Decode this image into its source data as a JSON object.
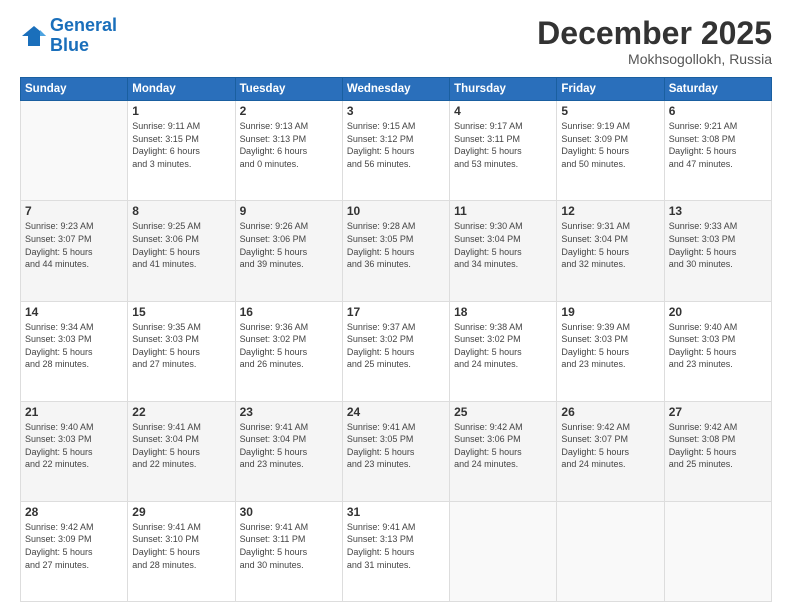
{
  "header": {
    "logo_line1": "General",
    "logo_line2": "Blue",
    "month": "December 2025",
    "location": "Mokhsogollokh, Russia"
  },
  "days_of_week": [
    "Sunday",
    "Monday",
    "Tuesday",
    "Wednesday",
    "Thursday",
    "Friday",
    "Saturday"
  ],
  "weeks": [
    [
      {
        "day": "",
        "info": ""
      },
      {
        "day": "1",
        "info": "Sunrise: 9:11 AM\nSunset: 3:15 PM\nDaylight: 6 hours\nand 3 minutes."
      },
      {
        "day": "2",
        "info": "Sunrise: 9:13 AM\nSunset: 3:13 PM\nDaylight: 6 hours\nand 0 minutes."
      },
      {
        "day": "3",
        "info": "Sunrise: 9:15 AM\nSunset: 3:12 PM\nDaylight: 5 hours\nand 56 minutes."
      },
      {
        "day": "4",
        "info": "Sunrise: 9:17 AM\nSunset: 3:11 PM\nDaylight: 5 hours\nand 53 minutes."
      },
      {
        "day": "5",
        "info": "Sunrise: 9:19 AM\nSunset: 3:09 PM\nDaylight: 5 hours\nand 50 minutes."
      },
      {
        "day": "6",
        "info": "Sunrise: 9:21 AM\nSunset: 3:08 PM\nDaylight: 5 hours\nand 47 minutes."
      }
    ],
    [
      {
        "day": "7",
        "info": "Sunrise: 9:23 AM\nSunset: 3:07 PM\nDaylight: 5 hours\nand 44 minutes."
      },
      {
        "day": "8",
        "info": "Sunrise: 9:25 AM\nSunset: 3:06 PM\nDaylight: 5 hours\nand 41 minutes."
      },
      {
        "day": "9",
        "info": "Sunrise: 9:26 AM\nSunset: 3:06 PM\nDaylight: 5 hours\nand 39 minutes."
      },
      {
        "day": "10",
        "info": "Sunrise: 9:28 AM\nSunset: 3:05 PM\nDaylight: 5 hours\nand 36 minutes."
      },
      {
        "day": "11",
        "info": "Sunrise: 9:30 AM\nSunset: 3:04 PM\nDaylight: 5 hours\nand 34 minutes."
      },
      {
        "day": "12",
        "info": "Sunrise: 9:31 AM\nSunset: 3:04 PM\nDaylight: 5 hours\nand 32 minutes."
      },
      {
        "day": "13",
        "info": "Sunrise: 9:33 AM\nSunset: 3:03 PM\nDaylight: 5 hours\nand 30 minutes."
      }
    ],
    [
      {
        "day": "14",
        "info": "Sunrise: 9:34 AM\nSunset: 3:03 PM\nDaylight: 5 hours\nand 28 minutes."
      },
      {
        "day": "15",
        "info": "Sunrise: 9:35 AM\nSunset: 3:03 PM\nDaylight: 5 hours\nand 27 minutes."
      },
      {
        "day": "16",
        "info": "Sunrise: 9:36 AM\nSunset: 3:02 PM\nDaylight: 5 hours\nand 26 minutes."
      },
      {
        "day": "17",
        "info": "Sunrise: 9:37 AM\nSunset: 3:02 PM\nDaylight: 5 hours\nand 25 minutes."
      },
      {
        "day": "18",
        "info": "Sunrise: 9:38 AM\nSunset: 3:02 PM\nDaylight: 5 hours\nand 24 minutes."
      },
      {
        "day": "19",
        "info": "Sunrise: 9:39 AM\nSunset: 3:03 PM\nDaylight: 5 hours\nand 23 minutes."
      },
      {
        "day": "20",
        "info": "Sunrise: 9:40 AM\nSunset: 3:03 PM\nDaylight: 5 hours\nand 23 minutes."
      }
    ],
    [
      {
        "day": "21",
        "info": "Sunrise: 9:40 AM\nSunset: 3:03 PM\nDaylight: 5 hours\nand 22 minutes."
      },
      {
        "day": "22",
        "info": "Sunrise: 9:41 AM\nSunset: 3:04 PM\nDaylight: 5 hours\nand 22 minutes."
      },
      {
        "day": "23",
        "info": "Sunrise: 9:41 AM\nSunset: 3:04 PM\nDaylight: 5 hours\nand 23 minutes."
      },
      {
        "day": "24",
        "info": "Sunrise: 9:41 AM\nSunset: 3:05 PM\nDaylight: 5 hours\nand 23 minutes."
      },
      {
        "day": "25",
        "info": "Sunrise: 9:42 AM\nSunset: 3:06 PM\nDaylight: 5 hours\nand 24 minutes."
      },
      {
        "day": "26",
        "info": "Sunrise: 9:42 AM\nSunset: 3:07 PM\nDaylight: 5 hours\nand 24 minutes."
      },
      {
        "day": "27",
        "info": "Sunrise: 9:42 AM\nSunset: 3:08 PM\nDaylight: 5 hours\nand 25 minutes."
      }
    ],
    [
      {
        "day": "28",
        "info": "Sunrise: 9:42 AM\nSunset: 3:09 PM\nDaylight: 5 hours\nand 27 minutes."
      },
      {
        "day": "29",
        "info": "Sunrise: 9:41 AM\nSunset: 3:10 PM\nDaylight: 5 hours\nand 28 minutes."
      },
      {
        "day": "30",
        "info": "Sunrise: 9:41 AM\nSunset: 3:11 PM\nDaylight: 5 hours\nand 30 minutes."
      },
      {
        "day": "31",
        "info": "Sunrise: 9:41 AM\nSunset: 3:13 PM\nDaylight: 5 hours\nand 31 minutes."
      },
      {
        "day": "",
        "info": ""
      },
      {
        "day": "",
        "info": ""
      },
      {
        "day": "",
        "info": ""
      }
    ]
  ]
}
